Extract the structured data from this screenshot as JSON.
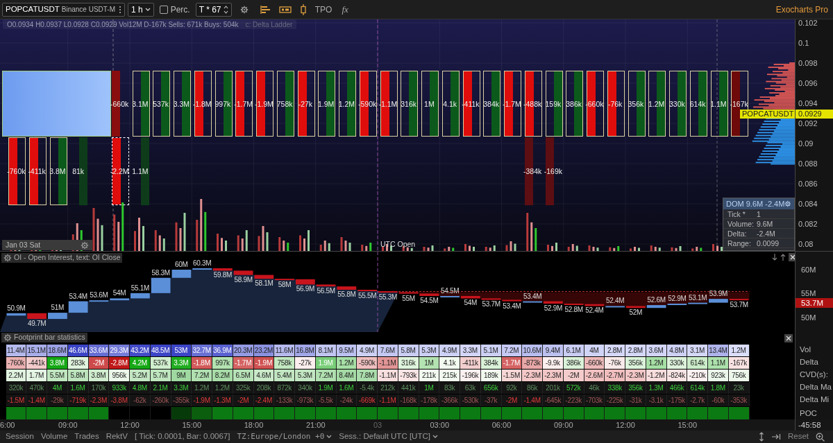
{
  "toolbar": {
    "symbol": "POPCATUSDT",
    "exchange": "Binance USDT-M",
    "timeframe": "1 h",
    "percent": {
      "label": "Perc.",
      "checked": false
    },
    "ticks": "T * 67",
    "tpo": "TPO",
    "formula": "fx",
    "brand": "Exocharts Pro"
  },
  "chart": {
    "ohlc_line": "O0.0934 H0.0937 L0.0928 C0.0929 Vol12M D-167k Sells: 671k Buys: 504k",
    "study": "c: Delta Ladder",
    "price_axis": [
      "0.102",
      "0.1",
      "0.098",
      "0.096",
      "0.094",
      "0.092",
      "0.09",
      "0.088",
      "0.086",
      "0.084",
      "0.082",
      "0.08"
    ],
    "last_price": {
      "symbol": "POPCATUSDT",
      "price": "0.0929"
    },
    "date_label": "Jan 03 Sat",
    "session_marker": "UTC Open",
    "dom": {
      "title": "DOM 9.6M -2.4M",
      "rows": [
        {
          "label": "Tick *",
          "value": "1"
        },
        {
          "label": "Volume:",
          "value": "9.6M"
        },
        {
          "label": "Delta:",
          "value": "-2.4M"
        },
        {
          "label": "Range:",
          "value": "0.0099"
        }
      ]
    },
    "lower_left": [
      {
        "delta": "-760k",
        "kind": "sell",
        "color": "#e00d0d",
        "boxed": true,
        "selected": false
      },
      {
        "delta": "-411k",
        "kind": "sell",
        "color": "#e00d0d",
        "boxed": true,
        "selected": false
      },
      {
        "delta": "3.8M",
        "kind": "buy",
        "color": "#0b5a1b",
        "boxed": true,
        "selected": false
      },
      {
        "delta": "81k",
        "kind": "buy",
        "color": "#0e3c1a",
        "boxed": false,
        "selected": false
      }
    ],
    "lower_middle": [
      {
        "delta": "-2.2M",
        "kind": "sell",
        "color": "#e00d0d",
        "boxed": true,
        "selected": true
      },
      {
        "delta": "1.1M",
        "kind": "buy",
        "color": "#0e3c1a",
        "boxed": false,
        "selected": false
      }
    ],
    "lower_right": [
      {
        "delta": "-384k",
        "kind": "sell",
        "color": "#5c0e12",
        "boxed": false,
        "selected": false
      },
      {
        "delta": "-169k",
        "kind": "sell",
        "color": "#5c0e12",
        "boxed": false,
        "selected": false
      }
    ],
    "upper_row": [
      {
        "delta": "-660k",
        "kind": "sell",
        "color": "#8a0e0e",
        "boxed": false,
        "selected": false
      },
      {
        "delta": "3.1M",
        "kind": "buy",
        "color": "#0b5a1b",
        "boxed": true,
        "selected": false
      },
      {
        "delta": "537k",
        "kind": "buy",
        "color": "#0b5a1b",
        "boxed": true,
        "selected": false
      },
      {
        "delta": "3.3M",
        "kind": "buy",
        "color": "#0b5a1b",
        "boxed": true,
        "selected": false
      },
      {
        "delta": "-1.8M",
        "kind": "sell",
        "color": "#e00d0d",
        "boxed": true,
        "selected": false
      },
      {
        "delta": "997k",
        "kind": "buy",
        "color": "#0b5a1b",
        "boxed": true,
        "selected": false
      },
      {
        "delta": "-1.7M",
        "kind": "sell",
        "color": "#e00d0d",
        "boxed": true,
        "selected": false
      },
      {
        "delta": "-1.9M",
        "kind": "sell",
        "color": "#e00d0d",
        "boxed": true,
        "selected": false
      },
      {
        "delta": "758k",
        "kind": "buy",
        "color": "#0b5a1b",
        "boxed": true,
        "selected": false
      },
      {
        "delta": "-27k",
        "kind": "sell",
        "color": "#e00d0d",
        "boxed": true,
        "selected": false
      },
      {
        "delta": "1.9M",
        "kind": "buy",
        "color": "#0b5a1b",
        "boxed": true,
        "selected": false
      },
      {
        "delta": "1.2M",
        "kind": "buy",
        "color": "#0b5a1b",
        "boxed": true,
        "selected": false
      },
      {
        "delta": "-590k",
        "kind": "sell",
        "color": "#e00d0d",
        "boxed": true,
        "selected": false
      },
      {
        "delta": "-1.1M",
        "kind": "sell",
        "color": "#e00d0d",
        "boxed": true,
        "selected": false
      },
      {
        "delta": "316k",
        "kind": "buy",
        "color": "#0b5a1b",
        "boxed": true,
        "selected": false
      },
      {
        "delta": "1M",
        "kind": "buy",
        "color": "#0b5a1b",
        "boxed": true,
        "selected": false
      },
      {
        "delta": "4.1k",
        "kind": "buy",
        "color": "#0b5a1b",
        "boxed": true,
        "selected": false
      },
      {
        "delta": "-411k",
        "kind": "sell",
        "color": "#e00d0d",
        "boxed": true,
        "selected": false
      },
      {
        "delta": "384k",
        "kind": "buy",
        "color": "#0b5a1b",
        "boxed": true,
        "selected": false
      },
      {
        "delta": "-1.7M",
        "kind": "sell",
        "color": "#e00d0d",
        "boxed": true,
        "selected": false
      },
      {
        "delta": "-488k",
        "kind": "sell",
        "color": "#e00d0d",
        "boxed": true,
        "selected": false
      },
      {
        "delta": "159k",
        "kind": "buy",
        "color": "#0b5a1b",
        "boxed": true,
        "selected": false
      },
      {
        "delta": "386k",
        "kind": "buy",
        "color": "#0b5a1b",
        "boxed": true,
        "selected": false
      },
      {
        "delta": "-660k",
        "kind": "sell",
        "color": "#e00d0d",
        "boxed": true,
        "selected": false
      },
      {
        "delta": "-76k",
        "kind": "sell",
        "color": "#e00d0d",
        "boxed": true,
        "selected": false
      },
      {
        "delta": "356k",
        "kind": "buy",
        "color": "#0b5a1b",
        "boxed": true,
        "selected": false
      },
      {
        "delta": "1.2M",
        "kind": "buy",
        "color": "#0b5a1b",
        "boxed": true,
        "selected": false
      },
      {
        "delta": "330k",
        "kind": "buy",
        "color": "#0b5a1b",
        "boxed": true,
        "selected": false
      },
      {
        "delta": "614k",
        "kind": "buy",
        "color": "#0b5a1b",
        "boxed": true,
        "selected": false
      },
      {
        "delta": "1.1M",
        "kind": "buy",
        "color": "#0b5a1b",
        "boxed": true,
        "selected": false
      },
      {
        "delta": "-167k",
        "kind": "sell",
        "color": "#6e0a0a",
        "boxed": true,
        "selected": false
      }
    ]
  },
  "oi": {
    "title": "OI - Open Interest, text: OI Close",
    "axis": [
      "60M",
      "55M",
      "50M"
    ],
    "last": "53.7M",
    "closes": [
      "50.9M",
      "49.7M",
      "51M",
      "53.4M",
      "53.6M",
      "54M",
      "55.1M",
      "58.3M",
      "60M",
      "60.3M",
      "59.8M",
      "58.9M",
      "58.1M",
      "58M",
      "56.9M",
      "56.5M",
      "55.8M",
      "55.5M",
      "55.3M",
      "55M",
      "54.5M",
      "54.5M",
      "54M",
      "53.7M",
      "53.4M",
      "53.4M",
      "52.9M",
      "52.8M",
      "52.4M",
      "52.4M",
      "52M",
      "52.6M",
      "52.9M",
      "53.1M",
      "53.9M",
      "53.7M"
    ]
  },
  "stats": {
    "title": "Footprint bar statistics",
    "rows": [
      {
        "label": "Vol",
        "kind": "volume",
        "cells": [
          "11.4M",
          "15.1M",
          "18.6M",
          "46.6M",
          "33.6M",
          "29.3M",
          "43.2M",
          "48.5M",
          "53M",
          "32.7M",
          "36.9M",
          "20.3M",
          "23.2M",
          "11.6M",
          "16.8M",
          "8.1M",
          "9.5M",
          "4.9M",
          "7.6M",
          "5.8M",
          "5.3M",
          "4.9M",
          "3.3M",
          "5.1M",
          "7.2M",
          "10.6M",
          "9.4M",
          "6.1M",
          "4M",
          "2.8M",
          "2.8M",
          "3.6M",
          "4.8M",
          "3.1M",
          "13.4M",
          "1.2M"
        ]
      },
      {
        "label": "Delta",
        "kind": "delta",
        "cells": [
          "-760k",
          "-441k",
          "3.8M",
          "283k",
          "-2M",
          "-2.8M",
          "4.2M",
          "537k",
          "3.3M",
          "-1.8M",
          "997k",
          "-1.7M",
          "-1.9M",
          "758k",
          "-27k",
          "1.9M",
          "1.2M",
          "-590k",
          "-1.1M",
          "316k",
          "1M",
          "4.1k",
          "-411k",
          "384k",
          "-1.7M",
          "-873k",
          "-9.9k",
          "386k",
          "-660k",
          "-76k",
          "356k",
          "1.2M",
          "330k",
          "614k",
          "1.1M",
          "-167k"
        ]
      },
      {
        "label": "CVD(s):",
        "kind": "cvd",
        "cells": [
          "2.2M",
          "1.7M",
          "5.5M",
          "5.8M",
          "3.8M",
          "956k",
          "5.2M",
          "5.7M",
          "9M",
          "7.2M",
          "8.2M",
          "6.5M",
          "4.6M",
          "5.4M",
          "5.3M",
          "7.2M",
          "8.4M",
          "7.8M",
          "-1.1M",
          "-793k",
          "211k",
          "215k",
          "-196k",
          "189k",
          "-1.5M",
          "-2.3M",
          "-2.3M",
          "-2M",
          "-2.6M",
          "-2.7M",
          "-2.3M",
          "-1.2M",
          "-824k",
          "-210k",
          "923k",
          "756k"
        ]
      },
      {
        "label": "Delta Ma",
        "kind": "max",
        "cells": [
          {
            "text": "320k",
            "strong": false
          },
          {
            "text": "470k",
            "strong": false
          },
          {
            "text": "4M",
            "strong": true
          },
          {
            "text": "1.6M",
            "strong": true
          },
          {
            "text": "170k",
            "strong": false
          },
          {
            "text": "933k",
            "strong": true
          },
          {
            "text": "4.8M",
            "strong": true
          },
          {
            "text": "2.1M",
            "strong": true
          },
          {
            "text": "3.3M",
            "strong": true
          },
          {
            "text": "1.2M",
            "strong": false
          },
          {
            "text": "1.2M",
            "strong": false
          },
          {
            "text": "325k",
            "strong": false
          },
          {
            "text": "208k",
            "strong": false
          },
          {
            "text": "872k",
            "strong": false
          },
          {
            "text": "340k",
            "strong": false
          },
          {
            "text": "1.9M",
            "strong": true
          },
          {
            "text": "1.6M",
            "strong": true
          },
          {
            "text": "-5.4k",
            "strong": false
          },
          {
            "text": "212k",
            "strong": false
          },
          {
            "text": "441k",
            "strong": false
          },
          {
            "text": "1M",
            "strong": true
          },
          {
            "text": "83k",
            "strong": false
          },
          {
            "text": "63k",
            "strong": false
          },
          {
            "text": "656k",
            "strong": true
          },
          {
            "text": "92k",
            "strong": false
          },
          {
            "text": "86k",
            "strong": false
          },
          {
            "text": "201k",
            "strong": false
          },
          {
            "text": "572k",
            "strong": true
          },
          {
            "text": "46k",
            "strong": false
          },
          {
            "text": "338k",
            "strong": true
          },
          {
            "text": "356k",
            "strong": true
          },
          {
            "text": "1.3M",
            "strong": true
          },
          {
            "text": "466k",
            "strong": true
          },
          {
            "text": "614k",
            "strong": true
          },
          {
            "text": "1.8M",
            "strong": true
          },
          {
            "text": "23k",
            "strong": false
          }
        ]
      },
      {
        "label": "Delta Mi",
        "kind": "min",
        "cells": [
          {
            "text": "-1.5M",
            "strong": true
          },
          {
            "text": "-1.4M",
            "strong": true
          },
          {
            "text": "-29k",
            "strong": false
          },
          {
            "text": "-719k",
            "strong": true
          },
          {
            "text": "-2.3M",
            "strong": true
          },
          {
            "text": "-3.8M",
            "strong": true
          },
          {
            "text": "-62k",
            "strong": false
          },
          {
            "text": "-260k",
            "strong": false
          },
          {
            "text": "-355k",
            "strong": false
          },
          {
            "text": "-1.9M",
            "strong": true
          },
          {
            "text": "-1.3M",
            "strong": true
          },
          {
            "text": "-2M",
            "strong": true
          },
          {
            "text": "-2.4M",
            "strong": true
          },
          {
            "text": "-133k",
            "strong": false
          },
          {
            "text": "-973k",
            "strong": false
          },
          {
            "text": "-5.5k",
            "strong": false
          },
          {
            "text": "-24k",
            "strong": false
          },
          {
            "text": "-669k",
            "strong": true
          },
          {
            "text": "-1.1M",
            "strong": true
          },
          {
            "text": "-168k",
            "strong": false
          },
          {
            "text": "-178k",
            "strong": false
          },
          {
            "text": "-366k",
            "strong": false
          },
          {
            "text": "-530k",
            "strong": false
          },
          {
            "text": "-37k",
            "strong": false
          },
          {
            "text": "-2M",
            "strong": true
          },
          {
            "text": "-1.4M",
            "strong": true
          },
          {
            "text": "-645k",
            "strong": false
          },
          {
            "text": "-223k",
            "strong": false
          },
          {
            "text": "-703k",
            "strong": false
          },
          {
            "text": "-225k",
            "strong": false
          },
          {
            "text": "-31k",
            "strong": false
          },
          {
            "text": "-3.1k",
            "strong": false
          },
          {
            "text": "-175k",
            "strong": false
          },
          {
            "text": "-2.7k",
            "strong": false
          },
          {
            "text": "-60k",
            "strong": false
          },
          {
            "text": "-353k",
            "strong": false
          }
        ]
      },
      {
        "label": "POC",
        "kind": "poc",
        "cells": [
          {
            "color": "#0b7a12"
          },
          {
            "color": "#0b7a12"
          },
          {
            "color": "#0b7a12"
          },
          {
            "color": "#0b7a12"
          },
          {
            "color": "#0b7a12"
          },
          {
            "color": "#000000"
          },
          {
            "color": "#000000"
          },
          {
            "color": "#000000"
          },
          {
            "color": "#063a08"
          },
          {
            "color": "#0a5e0e"
          },
          {
            "color": "#0b7a12"
          },
          {
            "color": "#0b7a12"
          },
          {
            "color": "#0b7a12"
          },
          {
            "color": "#0b7a12"
          },
          {
            "color": "#0b7a12"
          },
          {
            "color": "#0b7a12"
          },
          {
            "color": "#0b7a12"
          },
          {
            "color": "#0b7a12"
          },
          {
            "color": "#0b7a12"
          },
          {
            "color": "#0b7a12"
          },
          {
            "color": "#0b7a12"
          },
          {
            "color": "#0b7a12"
          },
          {
            "color": "#0b7a12"
          },
          {
            "color": "#0b7a12"
          },
          {
            "color": "#0b7a12"
          },
          {
            "color": "#0b7a12"
          },
          {
            "color": "#0b7a12"
          },
          {
            "color": "#0b7a12"
          },
          {
            "color": "#0b7a12"
          },
          {
            "color": "#0b7a12"
          },
          {
            "color": "#0b7a12"
          },
          {
            "color": "#0b7a12"
          },
          {
            "color": "#0b7a12"
          },
          {
            "color": "#0b7a12"
          },
          {
            "color": "#0b7a12"
          },
          {
            "color": "#0b7a12"
          }
        ]
      }
    ]
  },
  "time_axis": {
    "labels": [
      {
        "text": "6:00",
        "kind": "time"
      },
      {
        "text": "09:00",
        "kind": "time"
      },
      {
        "text": "12:00",
        "kind": "time"
      },
      {
        "text": "15:00",
        "kind": "time"
      },
      {
        "text": "18:00",
        "kind": "time"
      },
      {
        "text": "21:00",
        "kind": "time"
      },
      {
        "text": "03",
        "kind": "day"
      },
      {
        "text": "03:00",
        "kind": "time"
      },
      {
        "text": "06:00",
        "kind": "time"
      },
      {
        "text": "09:00",
        "kind": "time"
      },
      {
        "text": "12:00",
        "kind": "time"
      },
      {
        "text": "15:00",
        "kind": "time"
      }
    ],
    "countdown": "-45:58"
  },
  "status_bar": {
    "tabs": [
      "Session",
      "Volume",
      "Trades",
      "RektV"
    ],
    "info": "[ Tick: 0.0001, Bar: 0.0067]",
    "timezone": "TZ:Europe/London +0",
    "session": "Sess.: Default UTC [UTC]",
    "reset": "Reset"
  }
}
